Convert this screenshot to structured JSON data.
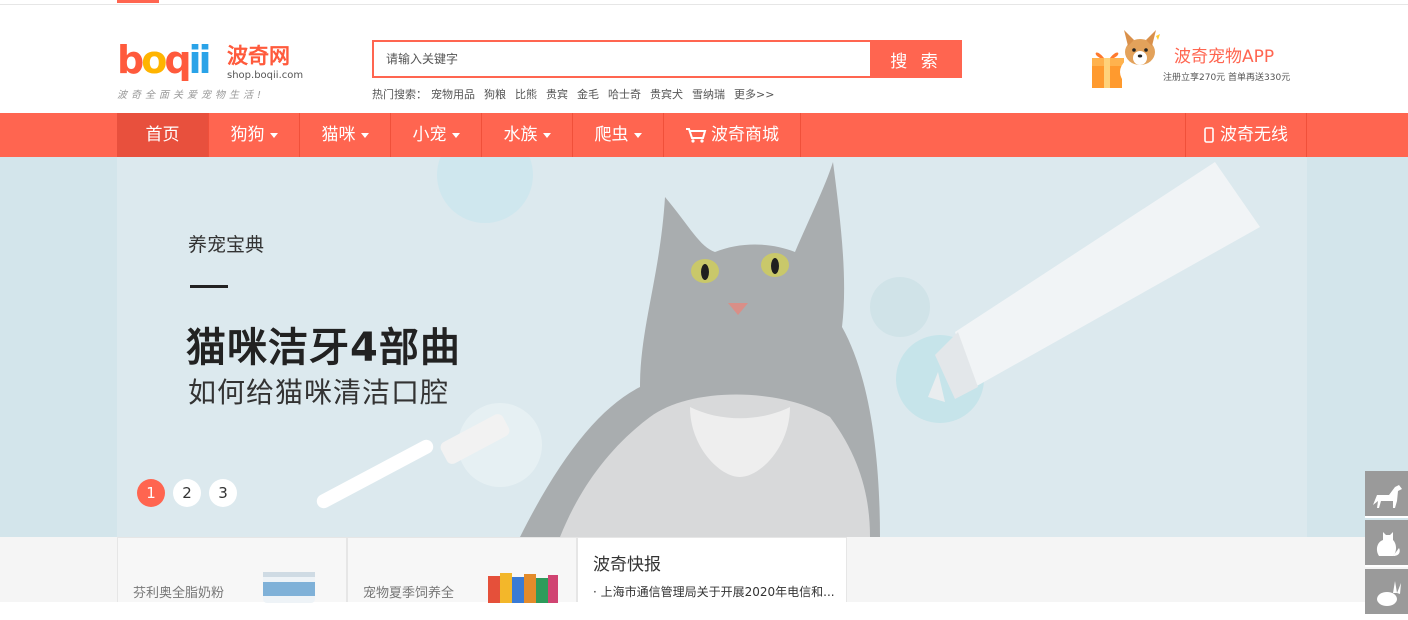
{
  "brand": {
    "logo_text": "boqii",
    "name_cn": "波奇网",
    "url": "shop.boqii.com",
    "slogan": "波奇全面关爱宠物生活!",
    "accent_color": "#ff6550"
  },
  "search": {
    "placeholder": "请输入关键字",
    "button_label": "搜 索",
    "hot_label": "热门搜索：",
    "hot_terms": [
      "宠物用品",
      "狗粮",
      "比熊",
      "贵宾",
      "金毛",
      "哈士奇",
      "贵宾犬",
      "雪纳瑞",
      "更多>>"
    ]
  },
  "app_promo": {
    "title": "波奇宠物APP",
    "subtitle": "注册立享270元 首单再送330元"
  },
  "nav": {
    "items": [
      {
        "label": "首页",
        "dropdown": false
      },
      {
        "label": "狗狗",
        "dropdown": true
      },
      {
        "label": "猫咪",
        "dropdown": true
      },
      {
        "label": "小宠",
        "dropdown": true
      },
      {
        "label": "水族",
        "dropdown": true
      },
      {
        "label": "爬虫",
        "dropdown": true
      },
      {
        "label": "波奇商城",
        "dropdown": false,
        "icon": "cart-icon"
      }
    ],
    "mobile_label": "波奇无线"
  },
  "banner": {
    "kicker": "养宠宝典",
    "headline": "猫咪洁牙4部曲",
    "subheadline": "如何给猫咪清洁口腔",
    "pages": [
      "1",
      "2",
      "3"
    ],
    "active_page": "1"
  },
  "panels": [
    {
      "text": "芬利奥全脂奶粉"
    },
    {
      "text": "宠物夏季饲养全"
    }
  ],
  "news": {
    "title": "波奇快报",
    "items": [
      "· 上海市通信管理局关于开展2020年电信和..."
    ]
  },
  "side_toolbar": {
    "icons": [
      "dog-icon",
      "cat-icon",
      "rabbit-icon"
    ]
  }
}
